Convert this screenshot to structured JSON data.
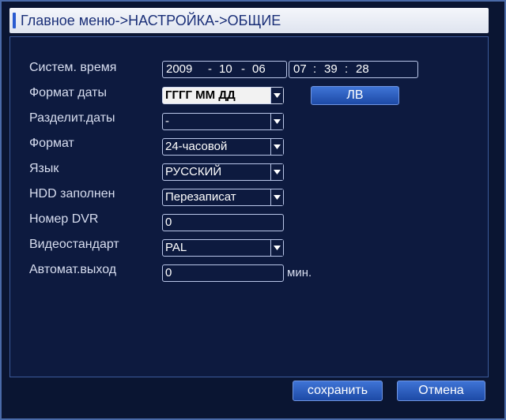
{
  "title": "Главное меню->НАСТРОЙКА->ОБЩИЕ",
  "fields": {
    "system_time": {
      "label": "Систем. время",
      "year": "2009",
      "month": "10",
      "day": "06",
      "hour": "07",
      "minute": "39",
      "second": "28",
      "date_sep": "-",
      "time_sep": ":"
    },
    "date_format": {
      "label": "Формат даты",
      "value": "ГГГГ ММ ДД"
    },
    "dst_button": "ЛВ",
    "date_separator": {
      "label": "Разделит.даты",
      "value": "-"
    },
    "time_format": {
      "label": "Формат",
      "value": "24-часовой"
    },
    "language": {
      "label": "Язык",
      "value": "РУССКИЙ"
    },
    "hdd_full": {
      "label": "HDD заполнен",
      "value": "Перезаписат"
    },
    "dvr_number": {
      "label": "Номер DVR",
      "value": "0"
    },
    "video_standard": {
      "label": "Видеостандарт",
      "value": "PAL"
    },
    "auto_logout": {
      "label": "Автомат.выход",
      "value": "0",
      "unit": "мин."
    }
  },
  "buttons": {
    "save": "сохранить",
    "cancel": "Отмена"
  }
}
